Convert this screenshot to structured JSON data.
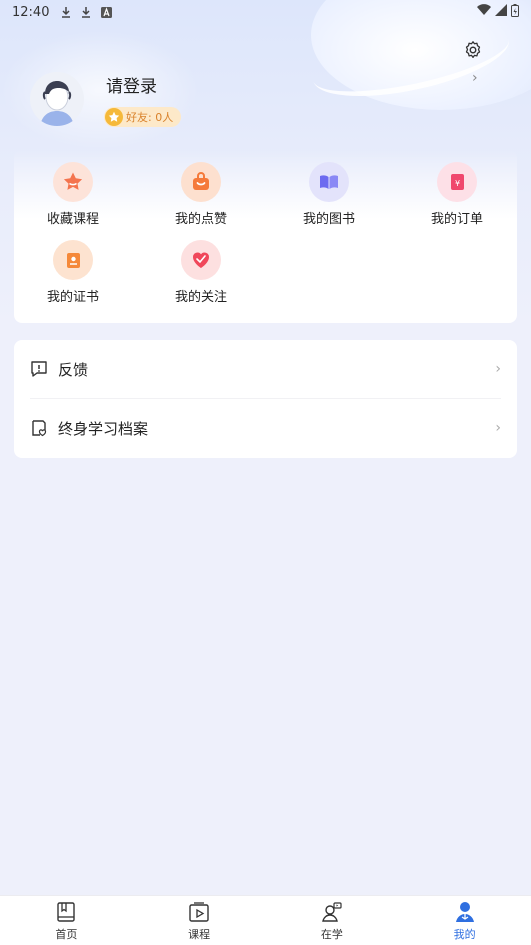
{
  "status_bar": {
    "time": "12:40"
  },
  "profile": {
    "title": "请登录",
    "friends_label": "好友: 0人"
  },
  "quick_actions": [
    {
      "label": "收藏课程",
      "icon": "star-favorite-icon",
      "color": "#f4744e",
      "bg": "#fde3d9"
    },
    {
      "label": "我的点赞",
      "icon": "like-bag-icon",
      "color": "#f57a3b",
      "bg": "#fde0cf"
    },
    {
      "label": "我的图书",
      "icon": "book-icon",
      "color": "#6d6bf0",
      "bg": "#e3e3fb"
    },
    {
      "label": "我的订单",
      "icon": "order-icon",
      "color": "#f0476d",
      "bg": "#fde0e7"
    },
    {
      "label": "我的证书",
      "icon": "certificate-icon",
      "color": "#f5893a",
      "bg": "#fde3d0"
    },
    {
      "label": "我的关注",
      "icon": "heart-icon",
      "color": "#f0475a",
      "bg": "#fde0e0"
    }
  ],
  "menu": [
    {
      "label": "反馈",
      "icon": "feedback-icon"
    },
    {
      "label": "终身学习档案",
      "icon": "archive-icon"
    }
  ],
  "tabs": [
    {
      "label": "首页",
      "icon": "home-book-icon",
      "active": false
    },
    {
      "label": "课程",
      "icon": "course-play-icon",
      "active": false
    },
    {
      "label": "在学",
      "icon": "learning-user-icon",
      "active": false
    },
    {
      "label": "我的",
      "icon": "profile-icon",
      "active": true
    }
  ],
  "colors": {
    "accent": "#2f6fe0",
    "page_bg": "#eef0fb"
  }
}
